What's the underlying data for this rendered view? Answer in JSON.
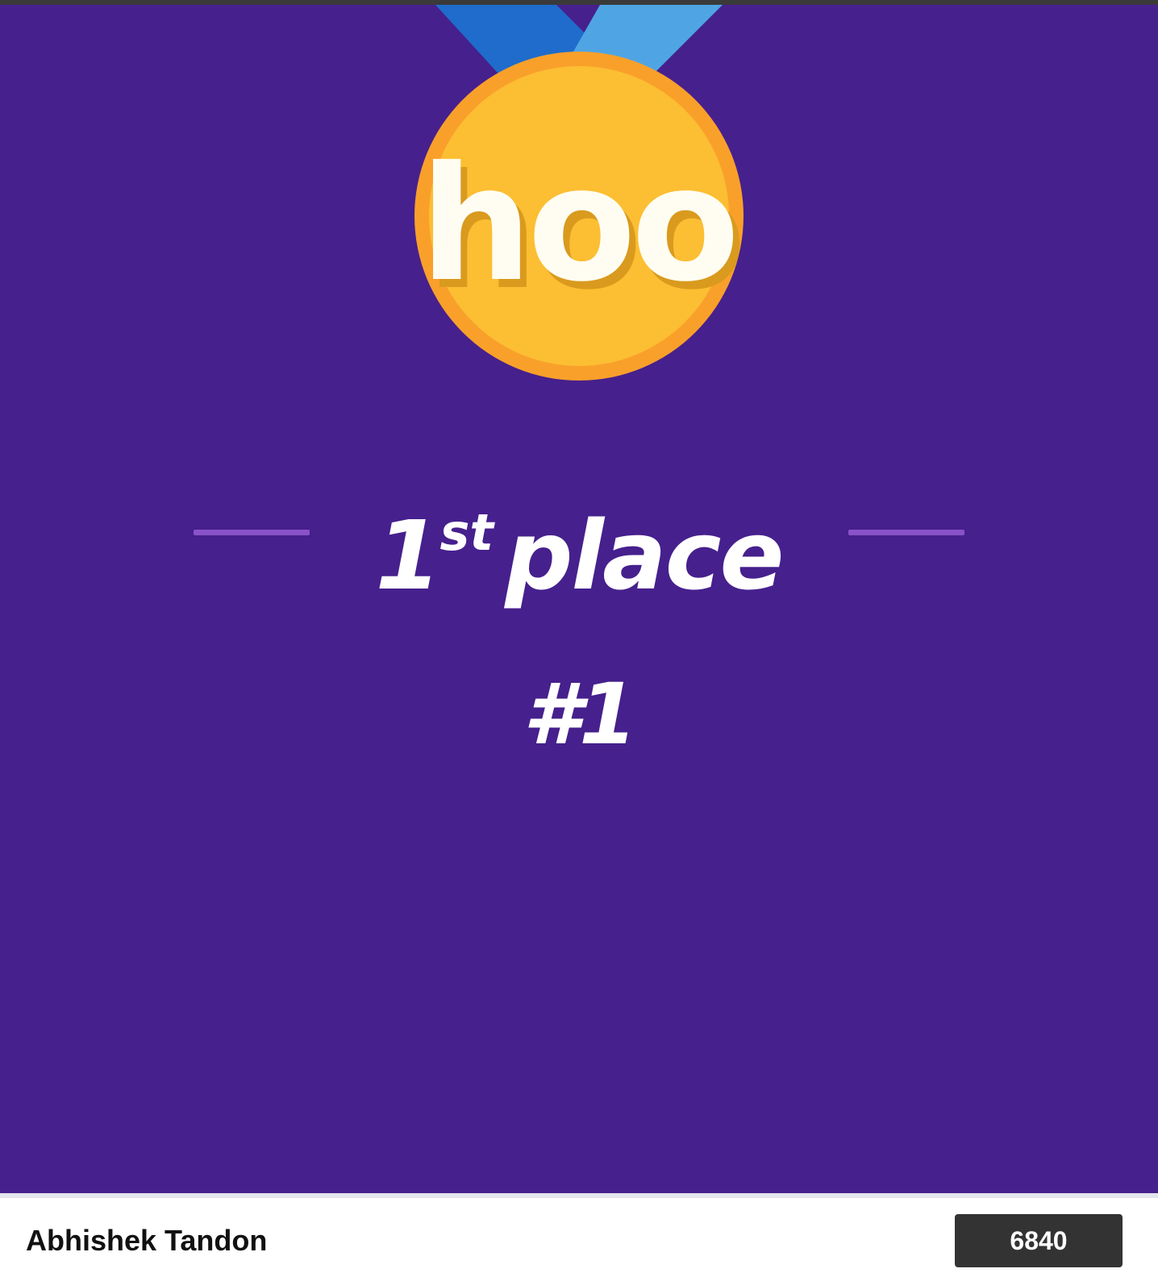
{
  "medal": {
    "logo_text": "hoo"
  },
  "result": {
    "place_number": "1",
    "place_ordinal": "st",
    "place_word": "place",
    "rank": "#1"
  },
  "player": {
    "name": "Abhishek Tandon",
    "score": "6840"
  },
  "colors": {
    "background": "#46208d",
    "medal_gold": "#fcbe32",
    "medal_rim": "#f9a02b",
    "ribbon_dark": "#1f6ccc",
    "ribbon_light": "#4fa5e4",
    "divider": "#8a52c8",
    "score_box": "#333333"
  }
}
